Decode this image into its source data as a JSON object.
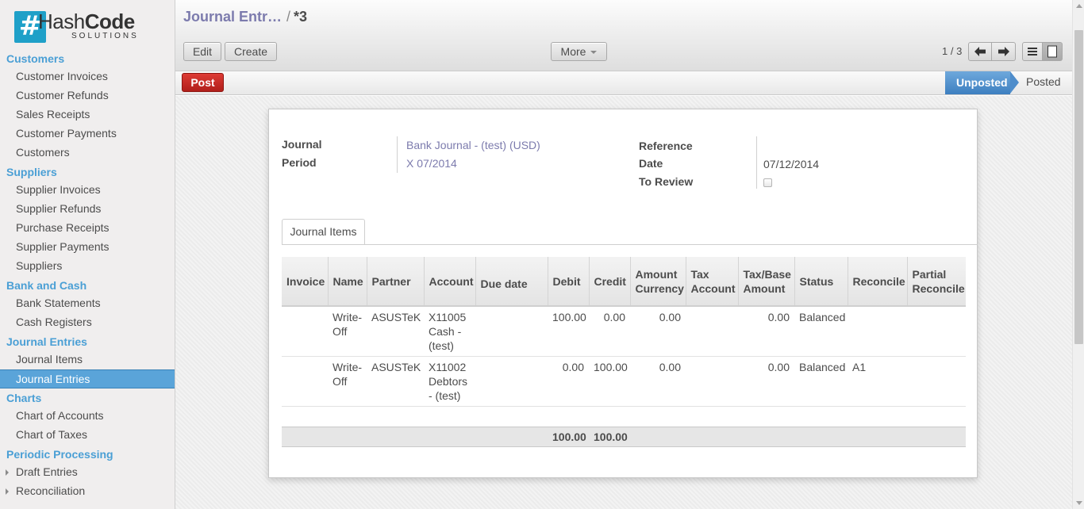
{
  "logo": {
    "mark": "#",
    "text_light": "Hash",
    "text_bold": "Code",
    "sub": "SOLUTIONS"
  },
  "sidebar": {
    "sections": [
      {
        "title": "Customers",
        "items": [
          "Customer Invoices",
          "Customer Refunds",
          "Sales Receipts",
          "Customer Payments",
          "Customers"
        ]
      },
      {
        "title": "Suppliers",
        "items": [
          "Supplier Invoices",
          "Supplier Refunds",
          "Purchase Receipts",
          "Supplier Payments",
          "Suppliers"
        ]
      },
      {
        "title": "Bank and Cash",
        "items": [
          "Bank Statements",
          "Cash Registers"
        ]
      },
      {
        "title": "Journal Entries",
        "items": [
          "Journal Items",
          "Journal Entries"
        ]
      },
      {
        "title": "Charts",
        "items": [
          "Chart of Accounts",
          "Chart of Taxes"
        ]
      },
      {
        "title": "Periodic Processing",
        "items": [
          "Draft Entries",
          "Reconciliation"
        ]
      }
    ],
    "active_item": "Journal Entries"
  },
  "breadcrumb": {
    "parent": "Journal Entr…",
    "separator": "/",
    "current": "*3"
  },
  "toolbar": {
    "edit": "Edit",
    "create": "Create",
    "more": "More"
  },
  "pager": {
    "text": "1 / 3"
  },
  "icons": {
    "prev": "arrow-left-icon",
    "next": "arrow-right-icon",
    "list_view": "list-view-icon",
    "form_view": "form-view-icon"
  },
  "statusbar": {
    "post": "Post",
    "stages": [
      "Unposted",
      "Posted"
    ],
    "current_stage": "Unposted"
  },
  "form": {
    "journal_label": "Journal",
    "journal_value": "Bank Journal - (test) (USD)",
    "period_label": "Period",
    "period_value": "X 07/2014",
    "reference_label": "Reference",
    "reference_value": "",
    "date_label": "Date",
    "date_value": "07/12/2014",
    "to_review_label": "To Review",
    "to_review_checked": false
  },
  "tabs": {
    "journal_items": "Journal Items"
  },
  "grid": {
    "headers": {
      "invoice": "Invoice",
      "name": "Name",
      "partner": "Partner",
      "account": "Account",
      "due_date": "Due date",
      "debit": "Debit",
      "credit": "Credit",
      "amount_currency": "Amount Currency",
      "tax_account": "Tax Account",
      "tax_base": "Tax/Base Amount",
      "status": "Status",
      "reconcile": "Reconcile",
      "partial_reconcile": "Partial Reconcile"
    },
    "rows": [
      {
        "invoice": "",
        "name": "Write-Off",
        "partner": "ASUSTeK",
        "account": "X11005 Cash - (test)",
        "due_date": "",
        "debit": "100.00",
        "credit": "0.00",
        "amount_currency": "0.00",
        "tax_account": "",
        "tax_base": "0.00",
        "status": "Balanced",
        "reconcile": "",
        "partial_reconcile": ""
      },
      {
        "invoice": "",
        "name": "Write-Off",
        "partner": "ASUSTeK",
        "account": "X11002 Debtors - (test)",
        "due_date": "",
        "debit": "0.00",
        "credit": "100.00",
        "amount_currency": "0.00",
        "tax_account": "",
        "tax_base": "0.00",
        "status": "Balanced",
        "reconcile": "A1",
        "partial_reconcile": ""
      }
    ],
    "totals": {
      "debit": "100.00",
      "credit": "100.00"
    }
  },
  "colors": {
    "brand": "#1fa0c8",
    "section": "#4a9fd5",
    "link": "#7c7bad",
    "active": "#5aa4d9",
    "post": "#c62a24",
    "stage": "#4f8dcb"
  }
}
